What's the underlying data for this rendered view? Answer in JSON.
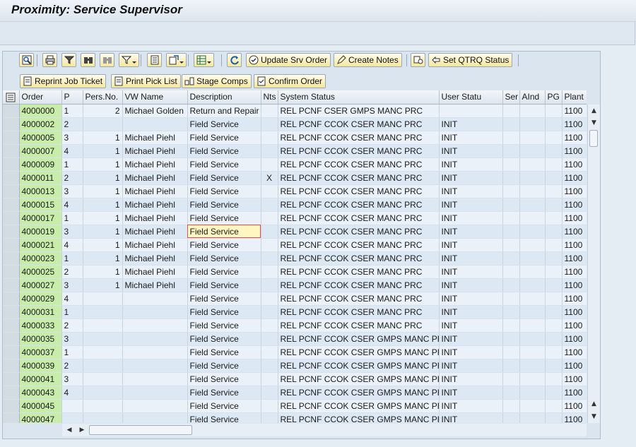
{
  "window": {
    "title": "Proximity: Service Supervisor"
  },
  "toolbar": {
    "icon_buttons": [
      {
        "icon": "details-icon"
      },
      {
        "icon": "print-icon"
      },
      {
        "icon": "filter-set-icon"
      },
      {
        "icon": "find-icon"
      },
      {
        "icon": "find-next-icon"
      },
      {
        "icon": "filter-icon",
        "dropdown": true
      },
      {
        "icon": "layout-page-icon"
      },
      {
        "icon": "export-icon",
        "dropdown": true
      },
      {
        "icon": "spreadsheet-icon",
        "dropdown": true
      },
      {
        "icon": "refresh-icon"
      }
    ],
    "update_srv_order": "Update Srv Order",
    "create_notes": "Create Notes",
    "set_qtrq_status": "Set QTRQ Status",
    "reprint_job_ticket": "Reprint Job Ticket",
    "print_pick_list": "Print Pick List",
    "stage_comps": "Stage Comps",
    "confirm_order": "Confirm Order"
  },
  "table": {
    "columns": [
      "Order",
      "P",
      "Pers.No.",
      "VW Name",
      "Description",
      "Nts",
      "System Status",
      "User Statu",
      "Ser",
      "AInd",
      "PG",
      "Plant"
    ],
    "rows": [
      [
        "4000000",
        "1",
        "2",
        "Michael Golden",
        "Return and Repair",
        "",
        "REL  PCNF CSER GMPS MANC PRC",
        "",
        "",
        "",
        "",
        "1100"
      ],
      [
        "4000002",
        "2",
        "",
        "",
        "Field Service",
        "",
        "REL  PCNF CCOK CSER MANC PRC",
        "INIT",
        "",
        "",
        "",
        "1100"
      ],
      [
        "4000005",
        "3",
        "1",
        "Michael Piehl",
        "Field Service",
        "",
        "REL  PCNF CCOK CSER MANC PRC",
        "INIT",
        "",
        "",
        "",
        "1100"
      ],
      [
        "4000007",
        "4",
        "1",
        "Michael Piehl",
        "Field Service",
        "",
        "REL  PCNF CCOK CSER MANC PRC",
        "INIT",
        "",
        "",
        "",
        "1100"
      ],
      [
        "4000009",
        "1",
        "1",
        "Michael Piehl",
        "Field Service",
        "",
        "REL  PCNF CCOK CSER MANC PRC",
        "INIT",
        "",
        "",
        "",
        "1100"
      ],
      [
        "4000011",
        "2",
        "1",
        "Michael Piehl",
        "Field Service",
        "X",
        "REL  PCNF CCOK CSER MANC PRC",
        "INIT",
        "",
        "",
        "",
        "1100"
      ],
      [
        "4000013",
        "3",
        "1",
        "Michael Piehl",
        "Field Service",
        "",
        "REL  PCNF CCOK CSER MANC PRC",
        "INIT",
        "",
        "",
        "",
        "1100"
      ],
      [
        "4000015",
        "4",
        "1",
        "Michael Piehl",
        "Field Service",
        "",
        "REL  PCNF CCOK CSER MANC PRC",
        "INIT",
        "",
        "",
        "",
        "1100"
      ],
      [
        "4000017",
        "1",
        "1",
        "Michael Piehl",
        "Field Service",
        "",
        "REL  PCNF CCOK CSER MANC PRC",
        "INIT",
        "",
        "",
        "",
        "1100"
      ],
      [
        "4000019",
        "3",
        "1",
        "Michael Piehl",
        "Field Service",
        "",
        "REL  PCNF CCOK CSER MANC PRC",
        "INIT",
        "",
        "",
        "",
        "1100"
      ],
      [
        "4000021",
        "4",
        "1",
        "Michael Piehl",
        "Field Service",
        "",
        "REL  PCNF CCOK CSER MANC PRC",
        "INIT",
        "",
        "",
        "",
        "1100"
      ],
      [
        "4000023",
        "1",
        "1",
        "Michael Piehl",
        "Field Service",
        "",
        "REL  PCNF CCOK CSER MANC PRC",
        "INIT",
        "",
        "",
        "",
        "1100"
      ],
      [
        "4000025",
        "2",
        "1",
        "Michael Piehl",
        "Field Service",
        "",
        "REL  PCNF CCOK CSER MANC PRC",
        "INIT",
        "",
        "",
        "",
        "1100"
      ],
      [
        "4000027",
        "3",
        "1",
        "Michael Piehl",
        "Field Service",
        "",
        "REL  PCNF CCOK CSER MANC PRC",
        "INIT",
        "",
        "",
        "",
        "1100"
      ],
      [
        "4000029",
        "4",
        "",
        "",
        "Field Service",
        "",
        "REL  PCNF CCOK CSER MANC PRC",
        "INIT",
        "",
        "",
        "",
        "1100"
      ],
      [
        "4000031",
        "1",
        "",
        "",
        "Field Service",
        "",
        "REL  PCNF CCOK CSER MANC PRC",
        "INIT",
        "",
        "",
        "",
        "1100"
      ],
      [
        "4000033",
        "2",
        "",
        "",
        "Field Service",
        "",
        "REL  PCNF CCOK CSER MANC PRC",
        "INIT",
        "",
        "",
        "",
        "1100"
      ],
      [
        "4000035",
        "3",
        "",
        "",
        "Field Service",
        "",
        "REL  PCNF CCOK CSER GMPS MANC PRC",
        "INIT",
        "",
        "",
        "",
        "1100"
      ],
      [
        "4000037",
        "1",
        "",
        "",
        "Field Service",
        "",
        "REL  PCNF CCOK CSER GMPS MANC PRC",
        "INIT",
        "",
        "",
        "",
        "1100"
      ],
      [
        "4000039",
        "2",
        "",
        "",
        "Field Service",
        "",
        "REL  PCNF CCOK CSER GMPS MANC PRC",
        "INIT",
        "",
        "",
        "",
        "1100"
      ],
      [
        "4000041",
        "3",
        "",
        "",
        "Field Service",
        "",
        "REL  PCNF CCOK CSER GMPS MANC PRC",
        "INIT",
        "",
        "",
        "",
        "1100"
      ],
      [
        "4000043",
        "4",
        "",
        "",
        "Field Service",
        "",
        "REL  PCNF CCOK CSER GMPS MANC PRC",
        "INIT",
        "",
        "",
        "",
        "1100"
      ],
      [
        "4000045",
        "",
        "",
        "",
        "Field Service",
        "",
        "REL  PCNF CCOK CSER GMPS MANC PRC",
        "INIT",
        "",
        "",
        "",
        "1100"
      ],
      [
        "4000047",
        "",
        "",
        "",
        "Field Service",
        "",
        "REL  PCNF CCOK CSER GMPS MANC PRC",
        "INIT",
        "",
        "",
        "",
        "1100"
      ]
    ],
    "focused_cell": {
      "row": 9,
      "column": "Description"
    }
  },
  "colors": {
    "order_cell": "#c8ecaa",
    "focus_cell": "#fff6c2",
    "button": "#f5e79e"
  }
}
